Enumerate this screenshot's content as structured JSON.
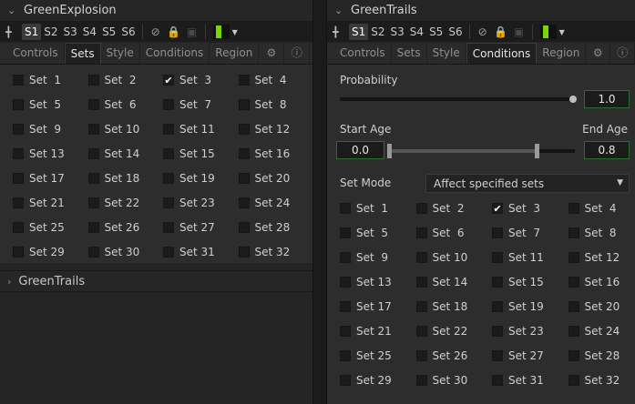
{
  "left_panel": {
    "title": "GreenExplosion",
    "versions": [
      "S1",
      "S2",
      "S3",
      "S4",
      "S5",
      "S6"
    ],
    "active_version": "S1",
    "color_swatch": "#7bd600",
    "tabs": [
      "Controls",
      "Sets",
      "Style",
      "Conditions",
      "Region"
    ],
    "active_tab": "Sets",
    "sets": [
      {
        "label": "Set  1",
        "checked": false
      },
      {
        "label": "Set  2",
        "checked": false
      },
      {
        "label": "Set  3",
        "checked": true
      },
      {
        "label": "Set  4",
        "checked": false
      },
      {
        "label": "Set  5",
        "checked": false
      },
      {
        "label": "Set  6",
        "checked": false
      },
      {
        "label": "Set  7",
        "checked": false
      },
      {
        "label": "Set  8",
        "checked": false
      },
      {
        "label": "Set  9",
        "checked": false
      },
      {
        "label": "Set 10",
        "checked": false
      },
      {
        "label": "Set 11",
        "checked": false
      },
      {
        "label": "Set 12",
        "checked": false
      },
      {
        "label": "Set 13",
        "checked": false
      },
      {
        "label": "Set 14",
        "checked": false
      },
      {
        "label": "Set 15",
        "checked": false
      },
      {
        "label": "Set 16",
        "checked": false
      },
      {
        "label": "Set 17",
        "checked": false
      },
      {
        "label": "Set 18",
        "checked": false
      },
      {
        "label": "Set 19",
        "checked": false
      },
      {
        "label": "Set 20",
        "checked": false
      },
      {
        "label": "Set 21",
        "checked": false
      },
      {
        "label": "Set 22",
        "checked": false
      },
      {
        "label": "Set 23",
        "checked": false
      },
      {
        "label": "Set 24",
        "checked": false
      },
      {
        "label": "Set 25",
        "checked": false
      },
      {
        "label": "Set 26",
        "checked": false
      },
      {
        "label": "Set 27",
        "checked": false
      },
      {
        "label": "Set 28",
        "checked": false
      },
      {
        "label": "Set 29",
        "checked": false
      },
      {
        "label": "Set 30",
        "checked": false
      },
      {
        "label": "Set 31",
        "checked": false
      },
      {
        "label": "Set 32",
        "checked": false
      }
    ],
    "collapsed_title": "GreenTrails"
  },
  "right_panel": {
    "title": "GreenTrails",
    "versions": [
      "S1",
      "S2",
      "S3",
      "S4",
      "S5",
      "S6"
    ],
    "active_version": "S1",
    "color_swatch": "#7bd600",
    "tabs": [
      "Controls",
      "Sets",
      "Style",
      "Conditions",
      "Region"
    ],
    "active_tab": "Conditions",
    "probability": {
      "label": "Probability",
      "value": "1.0",
      "fraction": 1.0
    },
    "age": {
      "start_label": "Start Age",
      "start_value": "0.0",
      "end_label": "End Age",
      "end_value": "0.8",
      "start_fraction": 0.0,
      "end_fraction": 0.8
    },
    "set_mode": {
      "label": "Set Mode",
      "value": "Affect specified sets"
    },
    "sets": [
      {
        "label": "Set  1",
        "checked": false
      },
      {
        "label": "Set  2",
        "checked": false
      },
      {
        "label": "Set  3",
        "checked": true
      },
      {
        "label": "Set  4",
        "checked": false
      },
      {
        "label": "Set  5",
        "checked": false
      },
      {
        "label": "Set  6",
        "checked": false
      },
      {
        "label": "Set  7",
        "checked": false
      },
      {
        "label": "Set  8",
        "checked": false
      },
      {
        "label": "Set  9",
        "checked": false
      },
      {
        "label": "Set 10",
        "checked": false
      },
      {
        "label": "Set 11",
        "checked": false
      },
      {
        "label": "Set 12",
        "checked": false
      },
      {
        "label": "Set 13",
        "checked": false
      },
      {
        "label": "Set 14",
        "checked": false
      },
      {
        "label": "Set 15",
        "checked": false
      },
      {
        "label": "Set 16",
        "checked": false
      },
      {
        "label": "Set 17",
        "checked": false
      },
      {
        "label": "Set 18",
        "checked": false
      },
      {
        "label": "Set 19",
        "checked": false
      },
      {
        "label": "Set 20",
        "checked": false
      },
      {
        "label": "Set 21",
        "checked": false
      },
      {
        "label": "Set 22",
        "checked": false
      },
      {
        "label": "Set 23",
        "checked": false
      },
      {
        "label": "Set 24",
        "checked": false
      },
      {
        "label": "Set 25",
        "checked": false
      },
      {
        "label": "Set 26",
        "checked": false
      },
      {
        "label": "Set 27",
        "checked": false
      },
      {
        "label": "Set 28",
        "checked": false
      },
      {
        "label": "Set 29",
        "checked": false
      },
      {
        "label": "Set 30",
        "checked": false
      },
      {
        "label": "Set 31",
        "checked": false
      },
      {
        "label": "Set 32",
        "checked": false
      }
    ]
  }
}
